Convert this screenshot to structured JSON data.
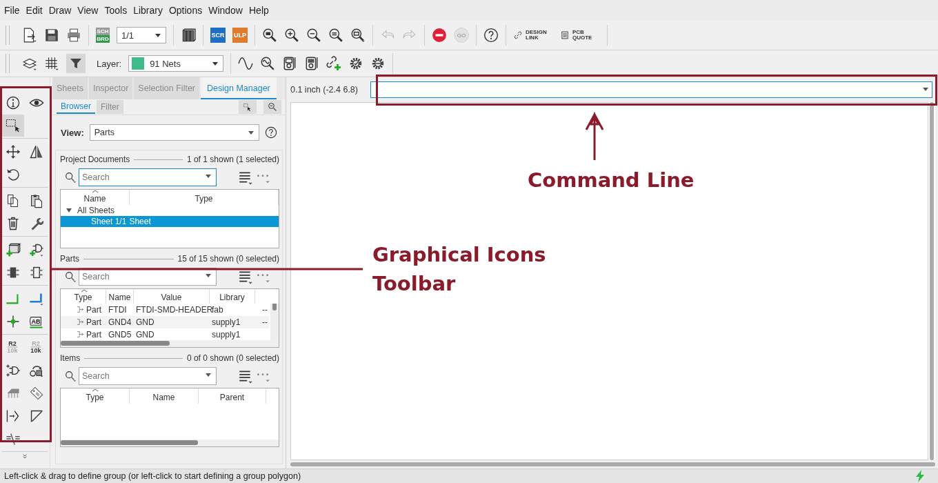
{
  "menu": [
    "File",
    "Edit",
    "Draw",
    "View",
    "Tools",
    "Library",
    "Options",
    "Window",
    "Help"
  ],
  "toolbar": {
    "sch_brd": [
      {
        "label": "SCH",
        "selected": false
      },
      {
        "label": "BRD",
        "selected": true
      }
    ],
    "sheet": "1/1",
    "scr": "SCR",
    "ulp": "ULP",
    "undo": {
      "disabled": true
    },
    "redo": {
      "disabled": true
    },
    "go": {
      "label": "GO",
      "disabled": true
    },
    "design_link": "DESIGN LINK",
    "pcb_quote": "PCB QUOTE"
  },
  "layer_bar": {
    "filter_on": true,
    "label": "Layer:",
    "layer": {
      "name": "91 Nets",
      "color": "#3dbb8a"
    }
  },
  "side_toolbar": {
    "groups": [
      [
        {
          "kind": "info",
          "selected": false
        },
        {
          "kind": "eye",
          "selected": false
        },
        {
          "kind": "select",
          "selected": true
        }
      ],
      [
        {
          "kind": "move",
          "selected": false
        },
        {
          "kind": "mirror",
          "selected": false
        },
        {
          "kind": "rotate",
          "selected": false
        }
      ],
      [
        {
          "kind": "copy",
          "selected": false
        },
        {
          "kind": "paste",
          "selected": false
        },
        {
          "kind": "delete",
          "selected": false
        },
        {
          "kind": "wrench",
          "selected": false
        }
      ],
      [
        {
          "kind": "add_part",
          "selected": false
        },
        {
          "kind": "add_gate",
          "selected": false
        },
        {
          "kind": "chip_dark",
          "selected": false
        },
        {
          "kind": "chip_outline",
          "selected": false
        }
      ],
      [
        {
          "kind": "wire_green",
          "selected": false
        },
        {
          "kind": "wire_blue",
          "selected": false
        },
        {
          "kind": "junction",
          "selected": false
        },
        {
          "kind": "label",
          "text": "AB",
          "selected": false
        }
      ],
      [
        {
          "kind": "name",
          "top": "R2",
          "bottom": "10k",
          "selected": false
        },
        {
          "kind": "value",
          "top": "R2",
          "bottom": "10k",
          "selected": false
        },
        {
          "kind": "gate_swap",
          "selected": false
        },
        {
          "kind": "change",
          "selected": false
        },
        {
          "kind": "chip_grey",
          "selected": false
        },
        {
          "kind": "tag",
          "selected": false
        },
        {
          "kind": "pin_arrow",
          "selected": false
        },
        {
          "kind": "miter",
          "selected": false
        },
        {
          "kind": "split",
          "selected": false
        }
      ]
    ]
  },
  "panel": {
    "tabs": [
      {
        "label": "Sheets",
        "selected": false
      },
      {
        "label": "Inspector",
        "selected": false
      },
      {
        "label": "Selection Filter",
        "selected": false
      },
      {
        "label": "Design Manager",
        "selected": true
      }
    ],
    "subtabs": [
      {
        "label": "Browser",
        "selected": true
      },
      {
        "label": "Filter",
        "selected": false
      }
    ],
    "view": {
      "label": "View:",
      "value": "Parts"
    },
    "project_documents": {
      "title": "Project Documents",
      "count": "1 of 1 shown (1 selected)",
      "search_placeholder": "Search",
      "columns": [
        "Name",
        "Type"
      ],
      "rows": [
        {
          "name": "All Sheets",
          "expanded": true,
          "children": [
            {
              "name": "Sheet 1/1",
              "type": "Sheet",
              "selected": true
            }
          ]
        }
      ]
    },
    "parts": {
      "title": "Parts",
      "count": "15 of 15 shown (0 selected)",
      "search_placeholder": "Search",
      "columns": [
        "Type",
        "Name",
        "Value",
        "Library"
      ],
      "rows": [
        [
          "Part",
          "FTDI",
          "FTDI-SMD-HEADER",
          "fab",
          "--"
        ],
        [
          "Part",
          "GND4",
          "GND",
          "supply1",
          "--"
        ],
        [
          "Part",
          "GND5",
          "GND",
          "supply1"
        ]
      ]
    },
    "items": {
      "title": "Items",
      "count": "0 of 0 shown (0 selected)",
      "search_placeholder": "Search",
      "columns": [
        "Type",
        "Name",
        "Parent"
      ]
    }
  },
  "canvas": {
    "coordinates": "0.1 inch (-2.4 6.8)"
  },
  "annotations": {
    "command_line": "Command Line",
    "toolbar": "Graphical Icons Toolbar"
  },
  "status_bar": {
    "text": "Left-click & drag to define group (or left-click to start defining a group polygon)"
  }
}
